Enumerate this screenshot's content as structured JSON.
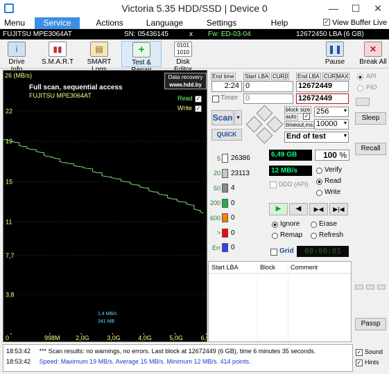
{
  "window": {
    "title": "Victoria 5.35 HDD/SSD | Device 0",
    "minimize": "—",
    "maximize": "☐",
    "close": "✕"
  },
  "menu": [
    "Menu",
    "Service",
    "Actions",
    "Language",
    "Settings",
    "Help"
  ],
  "view_buffer_live": "View Buffer Live",
  "infobar": {
    "model": "FUJITSU MPE3064AT",
    "sn": "SN: 05436145",
    "x": "x",
    "fw": "Fw: ED-03-04",
    "lba": "12672450 LBA (6 GB)"
  },
  "toolbar": {
    "drive_info": "Drive Info",
    "smart": "S.M.A.R.T",
    "smart_logs": "SMART Logs",
    "test_repair": "Test & Repair",
    "disk_editor": "Disk Editor",
    "pause": "Pause",
    "break_all": "Break All"
  },
  "graph": {
    "unit": "26 (MB/s)",
    "mode": "Full scan, sequential access",
    "drive": "FUJITSU MPE3064AT",
    "badge_line1": "Data recovery",
    "badge_line2": "www.hdd.by",
    "read": "Read",
    "write": "Write",
    "y_ticks": [
      "22",
      "19",
      "15",
      "11",
      "7,7",
      "3,8"
    ],
    "x_ticks": [
      "0",
      "998M",
      "2,0G",
      "3,0G",
      "4,0G",
      "5,0G",
      "6,0G"
    ],
    "speed_note": "1,4 MB/s",
    "size_note": "341 MB",
    "line_color": "#7ae07a"
  },
  "chart_data": {
    "type": "line",
    "title": "Full scan, sequential access",
    "ylabel": "MB/s",
    "ylim": [
      0,
      26
    ],
    "x_unit": "GB",
    "xlim": [
      0,
      6.5
    ],
    "series": [
      {
        "name": "Read",
        "x": [
          0,
          0.4,
          0.6,
          0.9,
          1.2,
          1.4,
          1.7,
          1.9,
          2.1,
          2.4,
          2.7,
          3.0,
          3.3,
          3.6,
          3.9,
          4.2,
          4.5,
          4.8,
          5.1,
          5.4,
          5.7,
          6.0,
          6.2,
          6.4
        ],
        "y": [
          19.2,
          19.0,
          18.6,
          18.3,
          18.0,
          17.6,
          17.4,
          17.0,
          16.9,
          16.6,
          16.4,
          16.0,
          15.6,
          15.4,
          15.1,
          14.8,
          14.5,
          14.1,
          13.8,
          13.4,
          13.1,
          12.8,
          12.3,
          12.0
        ]
      }
    ]
  },
  "lba": {
    "end_time_lbl": "End time",
    "end_time": "2:24",
    "start_lba_lbl": "Start LBA",
    "cur1": "CUR",
    "zero1": "0",
    "end_lba_lbl": "End LBA",
    "cur2": "CUR",
    "max": "MAX",
    "start_val": "0",
    "end_val": "12672449",
    "timer": "Timer",
    "timer_val": "0",
    "end_val2": "12672449"
  },
  "scan": {
    "scan": "Scan",
    "quick": "QUICK",
    "block_size_lbl": "block size",
    "auto_lbl": "auto",
    "block_size": "256",
    "timeout_lbl": "timeout,ms",
    "timeout": "10000",
    "end_of_test": "End of test"
  },
  "blocks": [
    {
      "label": "5",
      "count": "26386",
      "color": "#ffffff"
    },
    {
      "label": "20",
      "count": "23113",
      "color": "#c8c8c8"
    },
    {
      "label": "50",
      "count": "4",
      "color": "#8a8a8a"
    },
    {
      "label": "200",
      "count": "0",
      "color": "#22b14c"
    },
    {
      "label": "600",
      "count": "0",
      "color": "#ff8000"
    },
    {
      "label": ">",
      "count": "0",
      "color": "#ff0000"
    },
    {
      "label": "Err",
      "count": "0",
      "color": "#3040ff"
    }
  ],
  "progress": {
    "size": "6,49 GB",
    "percent": "100",
    "pct_sign": "%",
    "speed": "12 MB/s",
    "ddd": "DDD (API)",
    "verify": "Verify",
    "read": "Read",
    "write": "Write"
  },
  "actions": {
    "ignore": "Ignore",
    "erase": "Erase",
    "remap": "Remap",
    "refresh": "Refresh",
    "grid": "Grid",
    "clock": "00:00:01"
  },
  "table": {
    "columns": [
      "Start LBA",
      "Block",
      "Comment"
    ]
  },
  "right": {
    "api": "API",
    "pio": "PIO",
    "sleep": "Sleep",
    "recall": "Recall",
    "passp": "Passp"
  },
  "log": [
    {
      "time": "18:53:42",
      "text": "*** Scan results: no warnings, no errors. Last block at 12672449 (6 GB), time 6 minutes 35 seconds.",
      "color": "#000000"
    },
    {
      "time": "18:53:42",
      "text": "Speed: Maximum 19 MB/s. Average 15 MB/s. Minimum 12 MB/s. 414 points.",
      "color": "#1a3cc8"
    }
  ],
  "sound": "Sound",
  "hints": "Hints"
}
